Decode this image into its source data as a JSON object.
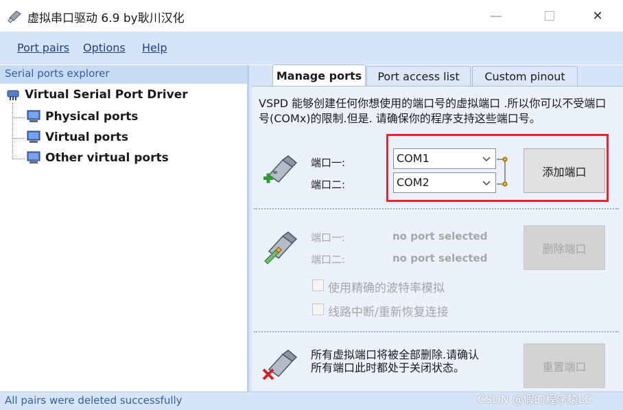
{
  "window": {
    "title": "虚拟串口驱动 6.9 by耿川汉化",
    "controls": [
      "minimize",
      "maximize",
      "close"
    ]
  },
  "menu": [
    {
      "label": "Port pairs"
    },
    {
      "label": "Options"
    },
    {
      "label": "Help"
    }
  ],
  "explorer": {
    "header": "Serial ports explorer",
    "root": "Virtual Serial Port Driver",
    "children": [
      "Physical ports",
      "Virtual ports",
      "Other virtual ports"
    ]
  },
  "tabs": [
    {
      "label": "Manage ports",
      "active": true
    },
    {
      "label": "Port access list",
      "active": false
    },
    {
      "label": "Custom pinout",
      "active": false
    }
  ],
  "manage": {
    "description": "VSPD 能够创建任何你想使用的端口号的虚拟端口 .所以你可以不受端口号(COMx)的限制.但是. 请确保你的程序支持这些端口号。",
    "add": {
      "port1_label": "端口一:",
      "port2_label": "端口二:",
      "port1_value": "COM1",
      "port2_value": "COM2",
      "button": "添加端口"
    },
    "remove": {
      "port1_label": "端口一:",
      "port2_label": "端口二:",
      "port1_value": "no port selected",
      "port2_value": "no port selected",
      "button": "删除端口",
      "option_baud": "使用精确的波特率模拟",
      "option_reconnect": "线路中断/重新恢复连接"
    },
    "reset": {
      "text": "所有虚拟端口将被全部删除.请确认所有端口此时都处于关闭状态。",
      "button": "重置端口"
    }
  },
  "status": {
    "text": "All pairs were deleted successfully"
  },
  "watermark": "CSDN @假的程序猿LC",
  "colors": {
    "menu_bg": "#d6e4f7",
    "menu_text": "#1c3f8a",
    "highlight": "#e8242c",
    "panel_bg": "#eaf1fb"
  }
}
